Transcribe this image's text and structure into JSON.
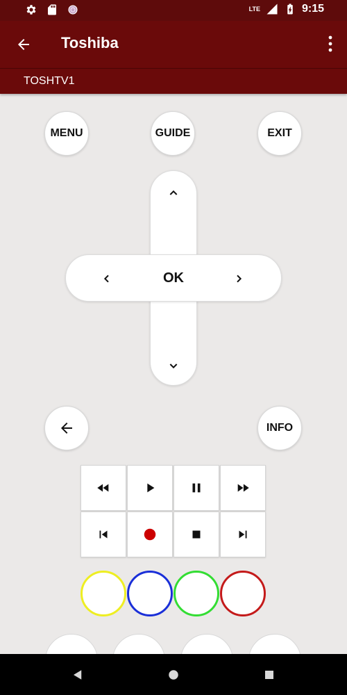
{
  "status_bar": {
    "time": "9:15",
    "network": "LTE",
    "icons": [
      "gear-icon",
      "sd-card-icon",
      "circle-icon",
      "signal-icon",
      "battery-icon"
    ]
  },
  "app_bar": {
    "title": "Toshiba",
    "back_icon": "arrow-back-icon",
    "menu_icon": "more-vert-icon"
  },
  "sub_bar": {
    "device": "TOSHTV1"
  },
  "top_buttons": {
    "menu": "MENU",
    "guide": "GUIDE",
    "exit": "EXIT"
  },
  "dpad": {
    "ok": "OK"
  },
  "mid_buttons": {
    "info": "INFO"
  },
  "media": {
    "row1": [
      "rewind-icon",
      "play-icon",
      "pause-icon",
      "fast-forward-icon"
    ],
    "row2": [
      "skip-previous-icon",
      "record-icon",
      "stop-icon",
      "skip-next-icon"
    ],
    "record_color": "#cc0000"
  },
  "color_buttons": [
    {
      "name": "yellow",
      "color": "#eeee22"
    },
    {
      "name": "blue",
      "color": "#1a2fd8"
    },
    {
      "name": "green",
      "color": "#33dd33"
    },
    {
      "name": "red",
      "color": "#c41a1a"
    }
  ],
  "theme": {
    "primary": "#6a0a0a",
    "status": "#5e0b0b",
    "background": "#ebe9e8"
  }
}
